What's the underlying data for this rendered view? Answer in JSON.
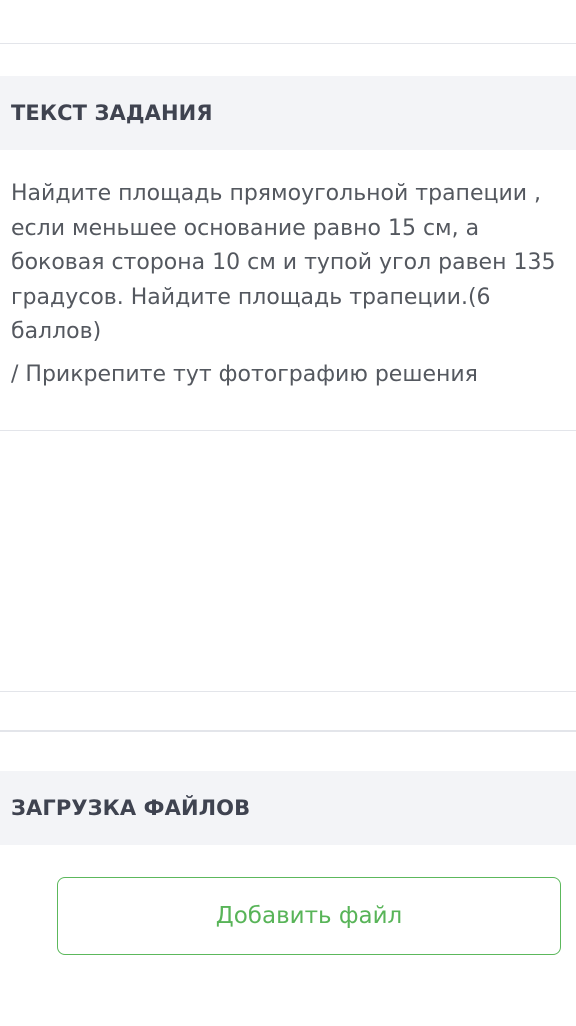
{
  "task_section": {
    "title": "ТЕКСТ ЗАДАНИЯ",
    "text": "Найдите площадь прямоугольной трапеции ,\nесли меньшее основание равно 15 см, а\nбоковая сторона 10 см и тупой угол равен 135\nградусов. Найдите площадь трапеции.(6\nбаллов)",
    "attach_hint": "/ Прикрепите тут фотографию решения"
  },
  "upload_section": {
    "title": "ЗАГРУЗКА ФАЙЛОВ",
    "add_file_label": "Добавить файл"
  },
  "colors": {
    "accent_green": "#5cb85c",
    "header_background": "#f3f4f7",
    "divider": "#e3e5ea"
  }
}
